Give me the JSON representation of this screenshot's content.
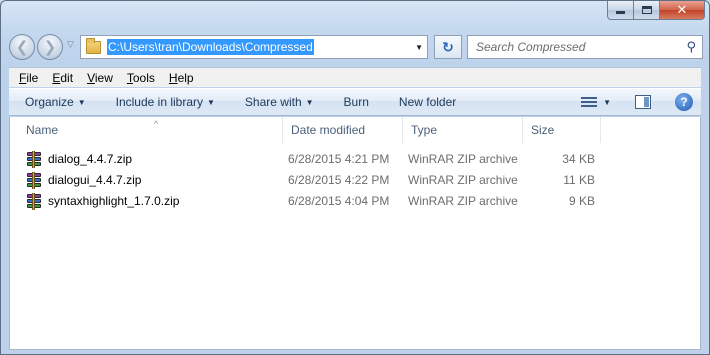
{
  "window": {
    "caption": {
      "minimize": "minimize-icon",
      "maximize": "maximize-icon",
      "close": "close-icon",
      "close_glyph": "✕"
    }
  },
  "nav": {
    "back_glyph": "❮",
    "forward_glyph": "❯",
    "recent_glyph": "▽",
    "address": "C:\\Users\\tran\\Downloads\\Compressed",
    "address_dropdown_glyph": "▼",
    "refresh_glyph": "↻",
    "search_placeholder": "Search Compressed",
    "search_glyph": "⚲"
  },
  "menubar": {
    "items": [
      {
        "key": "F",
        "rest": "ile"
      },
      {
        "key": "E",
        "rest": "dit"
      },
      {
        "key": "V",
        "rest": "iew"
      },
      {
        "key": "T",
        "rest": "ools"
      },
      {
        "key": "H",
        "rest": "elp"
      }
    ]
  },
  "toolbar": {
    "organize": "Organize",
    "include_in_library": "Include in library",
    "share_with": "Share with",
    "burn": "Burn",
    "new_folder": "New folder",
    "dropdown_glyph": "▼",
    "help_glyph": "?"
  },
  "columns": {
    "name": "Name",
    "date_modified": "Date modified",
    "type": "Type",
    "size": "Size",
    "sort_glyph": "^"
  },
  "files": [
    {
      "name": "dialog_4.4.7.zip",
      "date": "6/28/2015 4:21 PM",
      "type": "WinRAR ZIP archive",
      "size": "34 KB"
    },
    {
      "name": "dialogui_4.4.7.zip",
      "date": "6/28/2015 4:22 PM",
      "type": "WinRAR ZIP archive",
      "size": "11 KB"
    },
    {
      "name": "syntaxhighlight_1.7.0.zip",
      "date": "6/28/2015 4:04 PM",
      "type": "WinRAR ZIP archive",
      "size": "9 KB"
    }
  ],
  "colors": {
    "address_highlight": "#3399ff",
    "frame": "#c4d8ee",
    "close_button": "#c1432a"
  }
}
